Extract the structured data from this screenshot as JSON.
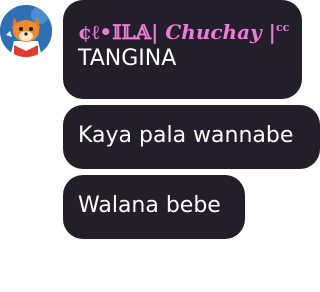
{
  "avatar": {
    "icon": "fox-character-avatar-icon",
    "bg_color": "#2f6fb5"
  },
  "colors": {
    "bubble_bg": "#221f2b",
    "sender_name": "#f07ad8",
    "message_text": "#ffffff"
  },
  "messages": [
    {
      "sender_prefix": "¢ℓ•𝕀𝕃𝔸| ",
      "sender_main": "Chuchay",
      "sender_suffix": " |",
      "sender_sup": "cc",
      "text": "TANGINA"
    },
    {
      "text": "Kaya pala wannabe"
    },
    {
      "text": "Walana bebe"
    }
  ]
}
